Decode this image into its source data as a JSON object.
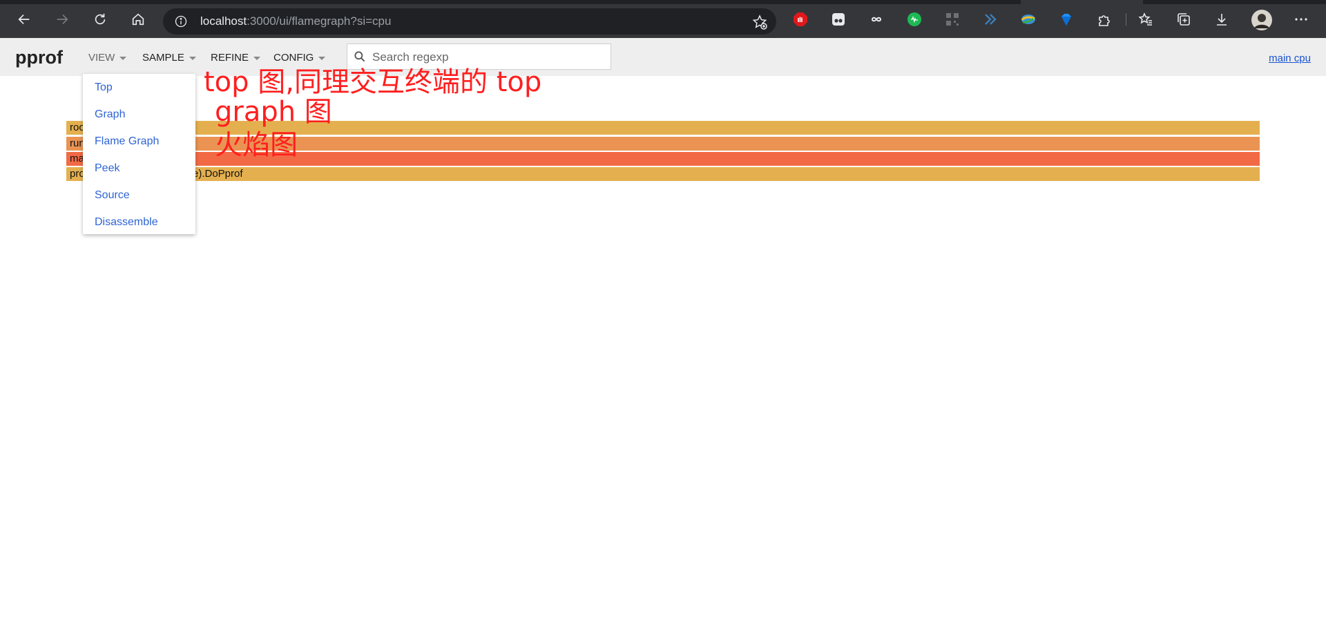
{
  "browser": {
    "url_host": "localhost",
    "url_path": ":3000/ui/flamegraph?si=cpu",
    "extensions": [
      "adblock-icon",
      "ghostery-icon",
      "infinity-icon",
      "spotify-icon",
      "qr-code-icon",
      "double-chevron-icon",
      "earth-icon",
      "gem-icon",
      "puzzle-icon"
    ],
    "colors": {
      "chrome": "#35363a",
      "address": "#202124"
    }
  },
  "header": {
    "title": "pprof",
    "menus": {
      "view": "VIEW",
      "sample": "SAMPLE",
      "refine": "REFINE",
      "config": "CONFIG"
    },
    "search_placeholder": "Search regexp",
    "profile_link": "main cpu"
  },
  "view_menu": {
    "items": [
      "Top",
      "Graph",
      "Flame Graph",
      "Peek",
      "Source",
      "Disassemble"
    ]
  },
  "flamegraph": {
    "rows": [
      {
        "label": "roo",
        "color": "#e4b04f"
      },
      {
        "label": "run",
        "color": "#ea9353"
      },
      {
        "label": "ma",
        "color": "#f26a45"
      },
      {
        "label": "pro",
        "suffix": "e).DoPprof",
        "color": "#e4b04f"
      }
    ]
  },
  "annotations": {
    "line1": "top 图,同理交互终端的 top",
    "line2": "graph 图",
    "line3": "火焰图",
    "color": "#ff1f1f"
  }
}
